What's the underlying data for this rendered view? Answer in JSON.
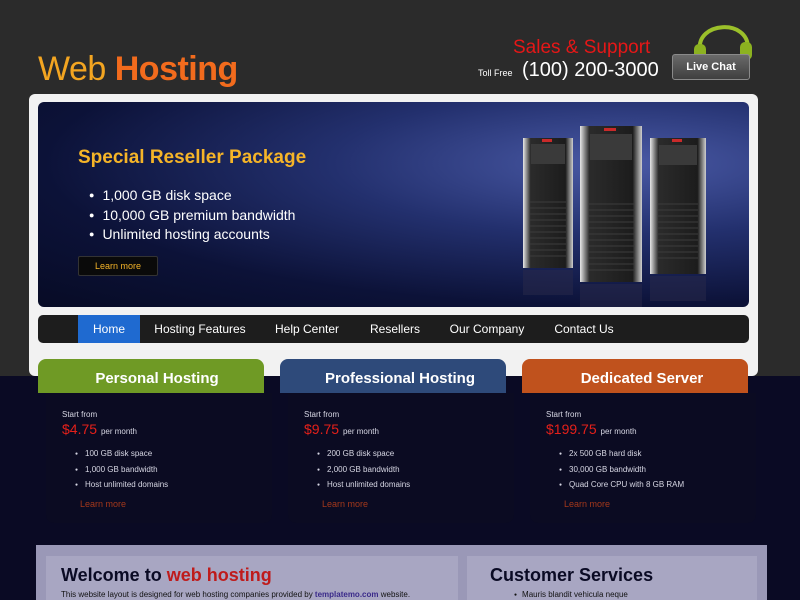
{
  "header": {
    "logo_part1": "Web ",
    "logo_part2": "Hosting",
    "sales_label": "Sales & Support",
    "toll_free_label": "Toll Free",
    "phone": "(100) 200-3000",
    "live_chat_label": "Live Chat",
    "colors": {
      "logo_orange": "#f26b1d",
      "logo_yellow": "#f3a521",
      "sales_red": "#e51717"
    }
  },
  "banner": {
    "title": "Special Reseller Package",
    "features": [
      "1,000 GB disk space",
      "10,000 GB premium bandwidth",
      "Unlimited hosting accounts"
    ],
    "button_label": "Learn more",
    "image_icon": "server-towers-icon"
  },
  "nav": {
    "items": [
      {
        "label": "Home",
        "active": true
      },
      {
        "label": "Hosting Features",
        "active": false
      },
      {
        "label": "Help Center",
        "active": false
      },
      {
        "label": "Resellers",
        "active": false
      },
      {
        "label": "Our Company",
        "active": false
      },
      {
        "label": "Contact Us",
        "active": false
      }
    ]
  },
  "plans": [
    {
      "title": "Personal Hosting",
      "start_label": "Start from",
      "price": "$4.75",
      "per": "per month",
      "features": [
        "100 GB disk space",
        "1,000 GB bandwidth",
        "Host unlimited domains"
      ],
      "more_label": "Learn more",
      "color": "#6f9a25"
    },
    {
      "title": "Professional Hosting",
      "start_label": "Start from",
      "price": "$9.75",
      "per": "per month",
      "features": [
        "200 GB disk space",
        "2,000 GB bandwidth",
        "Host unlimited domains"
      ],
      "more_label": "Learn more",
      "color": "#2e4a7a"
    },
    {
      "title": "Dedicated Server",
      "start_label": "Start from",
      "price": "$199.75",
      "per": "per month",
      "features": [
        "2x 500 GB hard disk",
        "30,000 GB bandwidth",
        "Quad Core CPU with 8 GB RAM"
      ],
      "more_label": "Learn more",
      "color": "#c0521d"
    }
  ],
  "welcome": {
    "title_plain": "Welcome to ",
    "title_highlight": "web hosting",
    "text_before_link": "This website layout is designed for web hosting companies provided by ",
    "link": "templatemo.com",
    "text_after_link": " website."
  },
  "customer_services": {
    "title": "Customer Services",
    "items": [
      "Mauris blandit vehicula neque"
    ]
  }
}
